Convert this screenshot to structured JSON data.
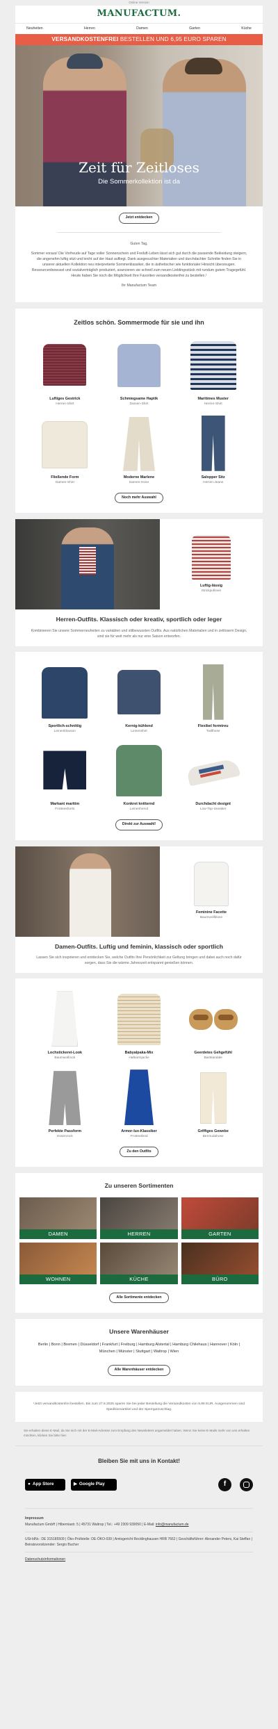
{
  "preheader": "Online Version",
  "brand": "MANUFACTUM.",
  "nav": [
    "Neuheiten",
    "Herren",
    "Damen",
    "Garten",
    "Küche"
  ],
  "promo": {
    "bold": "VERSANDKOSTENFREI",
    "rest": " BESTELLEN UND 6,95 EURO SPAREN"
  },
  "hero": {
    "title": "Zeit für Zeitloses",
    "subtitle": "Die Sommerkollektion ist da",
    "button": "Jetzt entdecken"
  },
  "intro": {
    "greeting": "Guten Tag,",
    "body": "Sommer voraus! Die Vorfreude auf Tage voller Sonnenschein und Freiluft-Leben lässt sich gut durch die passende Bekleidung steigern, die angenehm luftig sitzt und leicht auf der Haut aufliegt. Dank ausgesuchter Materialien und durchdachter Schnitte finden Sie in unserer aktuellen Kollektion neu interpretierte Sommerklassiker, die in ästhetischer wie funktionaler Hinsicht überzeugen. Ressourcenbewusst und sozialverträglich produziert, avancieren sie schnell zum neuen Lieblingsstück mit rundum gutem Tragegefühl. Heute haben Sie noch die Möglichkeit Ihre Favoriten versandkostenfrei zu bestellen.¹",
    "signoff": "Ihr Manufactum Team"
  },
  "section1": {
    "title": "Zeitlos schön. Sommermode für sie und ihn",
    "products": [
      {
        "name": "Luftiges Gestrick",
        "sub": "Herren-Shirt"
      },
      {
        "name": "Schmiegsame Haptik",
        "sub": "Damen-Shirt"
      },
      {
        "name": "Maritimes Muster",
        "sub": "Herren-Shirt"
      },
      {
        "name": "Fließende Form",
        "sub": "Damen-Shirt"
      },
      {
        "name": "Moderne Marlene",
        "sub": "Damen-Hose"
      },
      {
        "name": "Salopper Sitz",
        "sub": "Herren-Jeans"
      }
    ],
    "button": "Noch mehr Auswahl"
  },
  "men": {
    "feature": {
      "name": "Luftig-lässig",
      "sub": "Strickpullover"
    },
    "title": "Herren-Outfits. Klassisch oder kreativ, sportlich oder leger",
    "text": "Kombinieren Sie unsere Sommerneuheiten zu variablen und stilbewussten Outfits. Aus natürlichen Materialien und in zeitlosem Design, sind sie für weit mehr als nur eine Saison entworfen.",
    "products": [
      {
        "name": "Sportlich-schnittig",
        "sub": "Leinenblouson"
      },
      {
        "name": "Kernig-kühlend",
        "sub": "Leinenshirt"
      },
      {
        "name": "Flexibel formtreu",
        "sub": "Twillhose"
      },
      {
        "name": "Markant maritim",
        "sub": "Frotteeshorts"
      },
      {
        "name": "Konkret knitternd",
        "sub": "Leinenhemd"
      },
      {
        "name": "Durchdacht designt",
        "sub": "Low-Top-Sneaker"
      }
    ],
    "button": "Direkt zur Auswahl!"
  },
  "women": {
    "feature": {
      "name": "Feminine Facette",
      "sub": "Baumwollbluse"
    },
    "title": "Damen-Outfits. Luftig und feminin, klassisch oder sportlich",
    "text": "Lassen Sie sich inspirieren und entdecken Sie, welche Outfits Ihre Persönlichkeit zur Geltung bringen und dabei auch noch dafür sorgen, dass Sie die wärme Jahreszeit entspannt genießen können.",
    "products": [
      {
        "name": "Lochstickerei-Look",
        "sub": "Baumwollrock"
      },
      {
        "name": "Babyalpaka-Mix",
        "sub": "Halbarmjacke"
      },
      {
        "name": "Geerdetes Gehgefühl",
        "sub": "Bastsandale"
      },
      {
        "name": "Perfekte Passform",
        "sub": "Hosenrock"
      },
      {
        "name": "Armor-lux-Klassiker",
        "sub": "Frotteekleid"
      },
      {
        "name": "Griffiges Gewebe",
        "sub": "Bermudahose"
      }
    ],
    "button": "Zu den Outfits"
  },
  "assortment": {
    "title": "Zu unseren Sortimenten",
    "tiles": [
      "DAMEN",
      "HERREN",
      "GARTEN",
      "WOHNEN",
      "KÜCHE",
      "BÜRO"
    ],
    "button": "Alle Sortimente entdecken"
  },
  "stores": {
    "title": "Unsere Warenhäuser",
    "cities": "Berlin | Bonn | Bremen | Düsseldorf | Frankfurt | Freiburg | Hamburg Alstertal | Hamburg Chilehaus | Hannover | Köln | München | Münster | Stuttgart | Waltrop | Wien",
    "button": "Alle Warenhäuser entdecken"
  },
  "footnote": "¹Jetzt versandkostenfrei bestellen. Bis zum 27.6.2025 sparen Sie bei jeder Bestellung die Versandkosten von 6,95 EUR. Ausgenommen sind Speditionsartikel und der Sperrgutzuschlag.",
  "notice": "Sie erhalten diese E-Mail, da Sie sich mit der E-Mail-Adresse zum Empfang des Newsletters angemeldet haben. Wenn Sie keine E-Mails mehr von uns erhalten möchten, klicken Sie bitte hier.",
  "contact": "Bleiben Sie mit uns in Kontakt!",
  "apps": {
    "apple": "App Store",
    "google": "Google Play"
  },
  "imprint": {
    "title": "Impressum",
    "line1": "Manufactum GmbH | Hiberniastr. 5 | 45731 Waltrop | Tel.: +49 2309 939050 | E-Mail:",
    "email": "info@manufactum.de",
    "line2": "USt-IdNr.: DE 315185509 | Öko-Prüfstelle: DE-ÖKO-039 | Amtsgericht Recklinghausen HRB 7662 | Geschäftsführer: Alexander Peters, Kai Steffan | Beiratsvorsitzender: Sergio Bucher",
    "privacy": "Datenschutzinformationen"
  }
}
